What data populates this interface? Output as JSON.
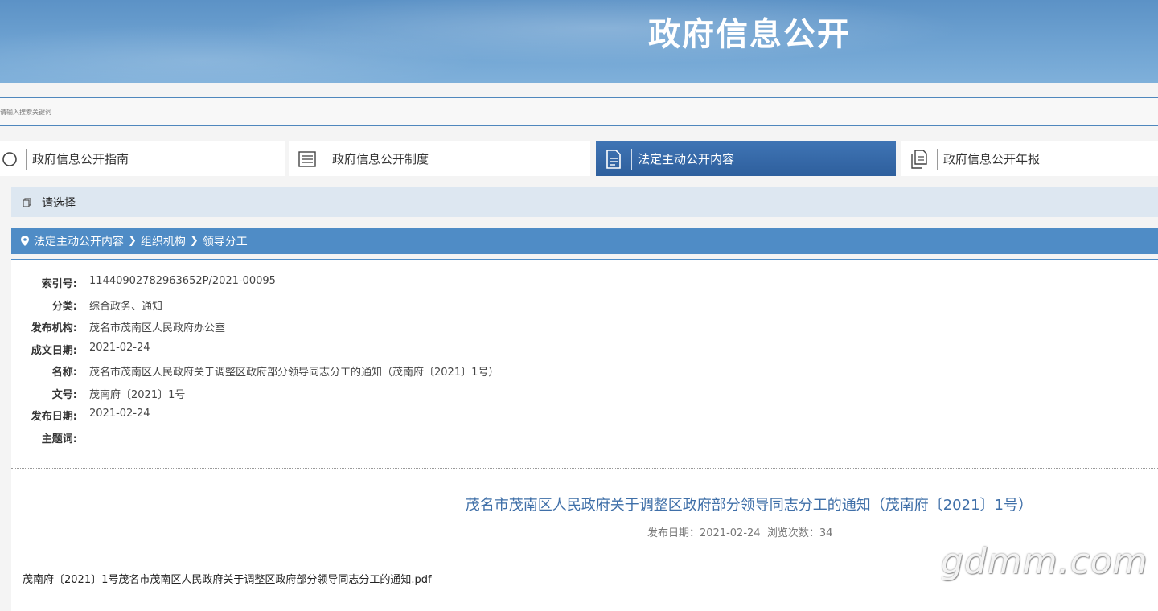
{
  "header": {
    "title": "政府信息公开"
  },
  "search": {
    "placeholder": "请输入搜索关键词"
  },
  "tabs": [
    {
      "label": "政府信息公开指南",
      "icon": "compass-icon",
      "active": false
    },
    {
      "label": "政府信息公开制度",
      "icon": "list-icon",
      "active": false
    },
    {
      "label": "法定主动公开内容",
      "icon": "document-icon",
      "active": true
    },
    {
      "label": "政府信息公开年报",
      "icon": "files-icon",
      "active": false
    }
  ],
  "select": {
    "label": "请选择"
  },
  "breadcrumb": {
    "items": [
      "法定主动公开内容",
      "组织机构",
      "领导分工"
    ]
  },
  "meta": [
    {
      "key": "索引号:",
      "value": "11440902782963652P/2021-00095"
    },
    {
      "key": "分类:",
      "value": "综合政务、通知"
    },
    {
      "key": "发布机构:",
      "value": "茂名市茂南区人民政府办公室"
    },
    {
      "key": "成文日期:",
      "value": "2021-02-24"
    },
    {
      "key": "名称:",
      "value": "茂名市茂南区人民政府关于调整区政府部分领导同志分工的通知（茂南府〔2021〕1号）"
    },
    {
      "key": "文号:",
      "value": "茂南府〔2021〕1号"
    },
    {
      "key": "发布日期:",
      "value": "2021-02-24"
    },
    {
      "key": "主题词:",
      "value": ""
    }
  ],
  "document": {
    "title": "茂名市茂南区人民政府关于调整区政府部分领导同志分工的通知（茂南府〔2021〕1号）",
    "publish_label": "发布日期：",
    "publish_date": "2021-02-24",
    "views_label": "浏览次数：",
    "views": "34",
    "attachment": "茂南府〔2021〕1号茂名市茂南区人民政府关于调整区政府部分领导同志分工的通知.pdf"
  },
  "watermark": "gdmm.com",
  "colors": {
    "accent": "#4f8cc6",
    "tab_active": "#2e5f9d",
    "title_blue": "#3f6fa8"
  }
}
